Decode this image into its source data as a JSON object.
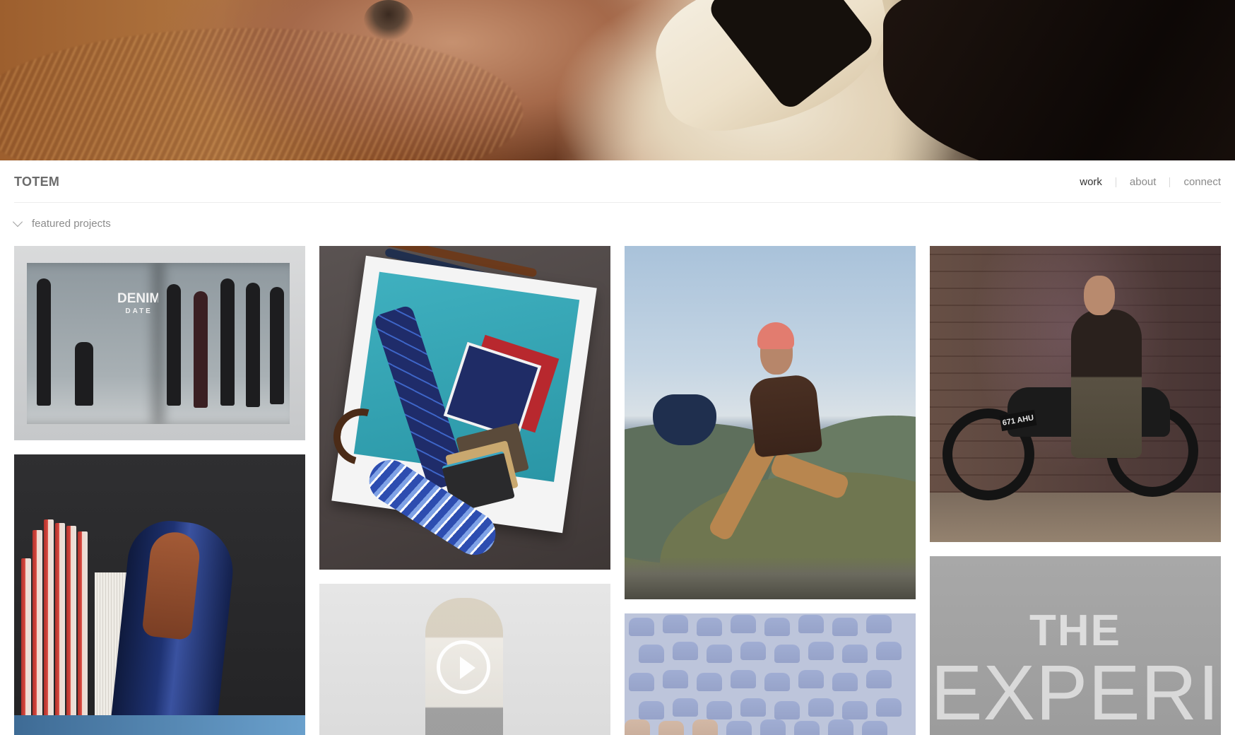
{
  "brand": {
    "name": "TOTEM"
  },
  "nav": {
    "items": [
      {
        "label": "work",
        "active": true
      },
      {
        "label": "about",
        "active": false
      },
      {
        "label": "connect",
        "active": false
      }
    ]
  },
  "section": {
    "label": "featured projects",
    "icon": "chevron-down-icon"
  },
  "projects": {
    "denim": {
      "headline": "DENIM",
      "subline": "DATE"
    },
    "motorbike": {
      "plate": "671 AHU"
    },
    "experience": {
      "line1": "THE",
      "line2": "EXPERI"
    },
    "video": {
      "icon": "play-icon"
    }
  },
  "colors": {
    "brand_text": "#6b6b6b",
    "nav_text": "#8a8a8a",
    "nav_active": "#333333",
    "divider": "#ececec"
  }
}
